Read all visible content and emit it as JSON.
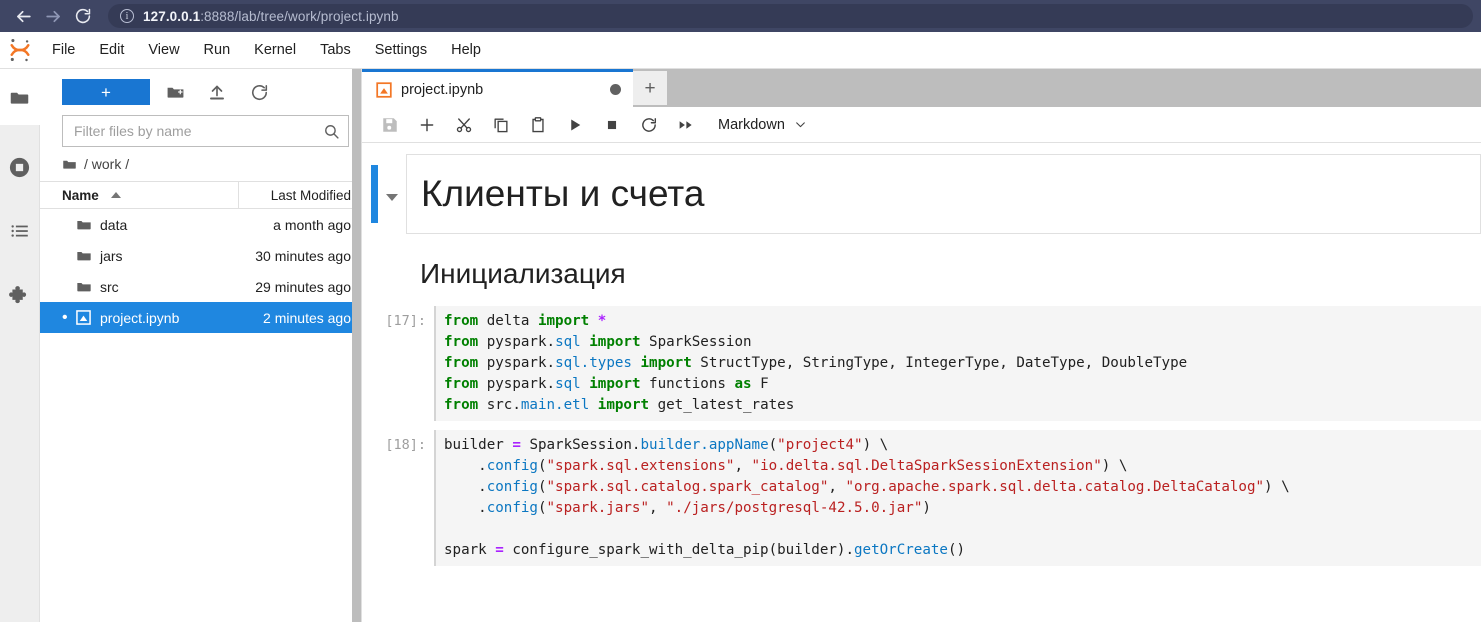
{
  "browser": {
    "back_icon": "arrow-left-icon",
    "forward_icon": "arrow-right-icon",
    "reload_icon": "reload-icon",
    "info_icon": "info-circle-icon",
    "url_host": "127.0.0.1",
    "url_rest": ":8888/lab/tree/work/project.ipynb",
    "chrome_bg": "#3f4664",
    "urlbar_bg": "#353b56"
  },
  "menu": {
    "logo_name": "jupyter-logo",
    "items": [
      {
        "label": "File"
      },
      {
        "label": "Edit"
      },
      {
        "label": "View"
      },
      {
        "label": "Run"
      },
      {
        "label": "Kernel"
      },
      {
        "label": "Tabs"
      },
      {
        "label": "Settings"
      },
      {
        "label": "Help"
      }
    ]
  },
  "activity_bar": {
    "items": [
      {
        "icon": "folder-icon",
        "name": "file-browser",
        "active": true
      },
      {
        "icon": "running-terminals-icon",
        "name": "running-sessions"
      },
      {
        "icon": "table-of-contents-icon",
        "name": "table-of-contents"
      },
      {
        "icon": "extension-puzzle-icon",
        "name": "extension-manager"
      }
    ]
  },
  "file_browser": {
    "new_launcher_label": "+",
    "tools": [
      {
        "name": "new-folder-icon"
      },
      {
        "name": "upload-icon"
      },
      {
        "name": "refresh-icon"
      }
    ],
    "filter_placeholder": "Filter files by name",
    "filter_value": "",
    "search_icon": "search-icon",
    "breadcrumb": "/ work /",
    "columns": {
      "name": "Name",
      "last_modified": "Last Modified"
    },
    "sort": "ascending",
    "rows": [
      {
        "name": "data",
        "modified": "a month ago",
        "type": "folder",
        "selected": false,
        "running": false
      },
      {
        "name": "jars",
        "modified": "30 minutes ago",
        "type": "folder",
        "selected": false,
        "running": false
      },
      {
        "name": "src",
        "modified": "29 minutes ago",
        "type": "folder",
        "selected": false,
        "running": false
      },
      {
        "name": "project.ipynb",
        "modified": "2 minutes ago",
        "type": "notebook",
        "selected": true,
        "running": true
      }
    ],
    "selection_color": "#1f87e0"
  },
  "notebook": {
    "tab_label": "project.ipynb",
    "tab_icon": "notebook-icon",
    "tab_dirty_indicator": "unsaved-changes-dot",
    "add_tab_label": "+",
    "toolbar": [
      {
        "name": "save-button",
        "icon": "save-icon",
        "disabled": true
      },
      {
        "name": "insert-cell-button",
        "icon": "plus-icon"
      },
      {
        "name": "cut-cell-button",
        "icon": "scissors-icon"
      },
      {
        "name": "copy-cell-button",
        "icon": "copy-icon"
      },
      {
        "name": "paste-cell-button",
        "icon": "paste-icon"
      },
      {
        "name": "run-cell-button",
        "icon": "play-icon"
      },
      {
        "name": "interrupt-kernel-button",
        "icon": "stop-square-icon"
      },
      {
        "name": "restart-kernel-button",
        "icon": "restart-icon"
      },
      {
        "name": "restart-and-run-all-button",
        "icon": "fast-forward-icon"
      }
    ],
    "cell_type_value": "Markdown",
    "cell_type_caret": "chevron-down-icon",
    "active_cell_color": "#1f87e0",
    "cells": [
      {
        "kind": "markdown",
        "level": "h1",
        "text": "Клиенты и счета",
        "active": true,
        "collapsible": true,
        "bordered": true
      },
      {
        "kind": "markdown",
        "level": "h2",
        "text": "Инициализация",
        "active": false,
        "collapsible": false,
        "bordered": false
      },
      {
        "kind": "code",
        "prompt": "[17]:",
        "lines": [
          [
            {
              "t": "from ",
              "c": "k"
            },
            {
              "t": "delta ",
              "c": "nm"
            },
            {
              "t": "import ",
              "c": "k"
            },
            {
              "t": "*",
              "c": "op"
            }
          ],
          [
            {
              "t": "from ",
              "c": "k"
            },
            {
              "t": "pyspark.",
              "c": "nm"
            },
            {
              "t": "sql ",
              "c": "at"
            },
            {
              "t": "import ",
              "c": "k"
            },
            {
              "t": "SparkSession",
              "c": "nm"
            }
          ],
          [
            {
              "t": "from ",
              "c": "k"
            },
            {
              "t": "pyspark.",
              "c": "nm"
            },
            {
              "t": "sql.",
              "c": "at"
            },
            {
              "t": "types ",
              "c": "at"
            },
            {
              "t": "import ",
              "c": "k"
            },
            {
              "t": "StructType, StringType, IntegerType, DateType, DoubleType",
              "c": "nm"
            }
          ],
          [
            {
              "t": "from ",
              "c": "k"
            },
            {
              "t": "pyspark.",
              "c": "nm"
            },
            {
              "t": "sql ",
              "c": "at"
            },
            {
              "t": "import ",
              "c": "k"
            },
            {
              "t": "functions ",
              "c": "nm"
            },
            {
              "t": "as ",
              "c": "k"
            },
            {
              "t": "F",
              "c": "nm"
            }
          ],
          [
            {
              "t": "from ",
              "c": "k"
            },
            {
              "t": "src.",
              "c": "nm"
            },
            {
              "t": "main.",
              "c": "at"
            },
            {
              "t": "etl ",
              "c": "at"
            },
            {
              "t": "import ",
              "c": "k"
            },
            {
              "t": "get_latest_rates",
              "c": "nm"
            }
          ]
        ]
      },
      {
        "kind": "code",
        "prompt": "[18]:",
        "lines": [
          [
            {
              "t": "builder ",
              "c": "nm"
            },
            {
              "t": "= ",
              "c": "op"
            },
            {
              "t": "SparkSession.",
              "c": "nm"
            },
            {
              "t": "builder.",
              "c": "at"
            },
            {
              "t": "appName",
              "c": "fn"
            },
            {
              "t": "(",
              "c": "nm"
            },
            {
              "t": "\"project4\"",
              "c": "st"
            },
            {
              "t": ") \\",
              "c": "nm"
            }
          ],
          [
            {
              "t": "    .",
              "c": "nm"
            },
            {
              "t": "config",
              "c": "fn"
            },
            {
              "t": "(",
              "c": "nm"
            },
            {
              "t": "\"spark.sql.extensions\"",
              "c": "st"
            },
            {
              "t": ", ",
              "c": "nm"
            },
            {
              "t": "\"io.delta.sql.DeltaSparkSessionExtension\"",
              "c": "st"
            },
            {
              "t": ") \\",
              "c": "nm"
            }
          ],
          [
            {
              "t": "    .",
              "c": "nm"
            },
            {
              "t": "config",
              "c": "fn"
            },
            {
              "t": "(",
              "c": "nm"
            },
            {
              "t": "\"spark.sql.catalog.spark_catalog\"",
              "c": "st"
            },
            {
              "t": ", ",
              "c": "nm"
            },
            {
              "t": "\"org.apache.spark.sql.delta.catalog.DeltaCatalog\"",
              "c": "st"
            },
            {
              "t": ") \\",
              "c": "nm"
            }
          ],
          [
            {
              "t": "    .",
              "c": "nm"
            },
            {
              "t": "config",
              "c": "fn"
            },
            {
              "t": "(",
              "c": "nm"
            },
            {
              "t": "\"spark.jars\"",
              "c": "st"
            },
            {
              "t": ", ",
              "c": "nm"
            },
            {
              "t": "\"./jars/postgresql-42.5.0.jar\"",
              "c": "st"
            },
            {
              "t": ")",
              "c": "nm"
            }
          ],
          [
            {
              "t": "",
              "c": "nm"
            }
          ],
          [
            {
              "t": "spark ",
              "c": "nm"
            },
            {
              "t": "= ",
              "c": "op"
            },
            {
              "t": "configure_spark_with_delta_pip",
              "c": "nm"
            },
            {
              "t": "(builder).",
              "c": "nm"
            },
            {
              "t": "getOrCreate",
              "c": "fn"
            },
            {
              "t": "()",
              "c": "nm"
            }
          ]
        ]
      }
    ]
  }
}
